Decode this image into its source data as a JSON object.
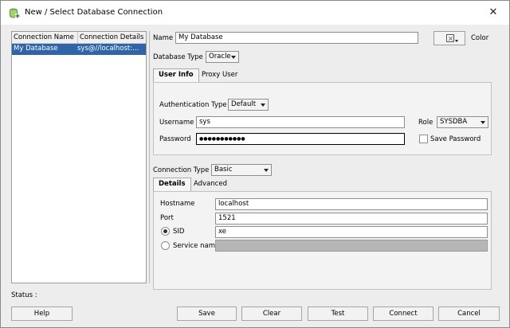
{
  "window": {
    "title": "New / Select Database Connection",
    "close_glyph": "✕",
    "icon": "database-plus-icon"
  },
  "connections": {
    "columns": [
      "Connection Name",
      "Connection Details"
    ],
    "rows": [
      {
        "name": "My Database",
        "details": "sys@//localhost:..."
      }
    ]
  },
  "form": {
    "name_label": "Name",
    "name_value": "My Database",
    "color_label": "Color",
    "database_type_label": "Database Type",
    "database_type_value": "Oracle",
    "tabs": [
      "User Info",
      "Proxy User"
    ],
    "auth_type_label": "Authentication Type",
    "auth_type_value": "Default",
    "username_label": "Username",
    "username_value": "sys",
    "password_label": "Password",
    "password_value": "●●●●●●●●●●●",
    "role_label": "Role",
    "role_value": "SYSDBA",
    "save_password_label": "Save Password",
    "save_password_checked": false,
    "connection_type_label": "Connection Type",
    "connection_type_value": "Basic",
    "detail_tabs": [
      "Details",
      "Advanced"
    ],
    "hostname_label": "Hostname",
    "hostname_value": "localhost",
    "port_label": "Port",
    "port_value": "1521",
    "sid_label": "SID",
    "sid_value": "xe",
    "sid_selected": true,
    "service_name_label": "Service name",
    "service_name_value": ""
  },
  "status": {
    "label": "Status :"
  },
  "buttons": {
    "help": "Help",
    "save": "Save",
    "clear": "Clear",
    "test": "Test",
    "connect": "Connect",
    "cancel": "Cancel"
  }
}
